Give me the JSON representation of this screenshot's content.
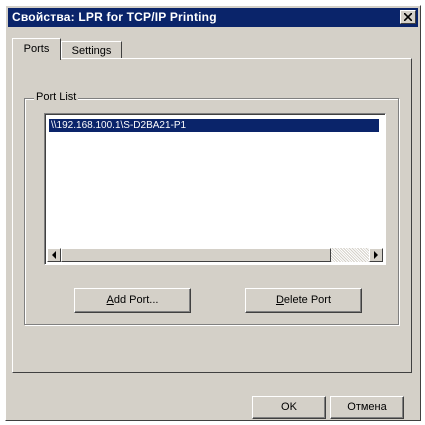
{
  "window": {
    "title": "Свойства: LPR for TCP/IP Printing"
  },
  "tabs": [
    {
      "label": "Ports"
    },
    {
      "label": "Settings"
    }
  ],
  "port_list": {
    "label": "Port List",
    "items": [
      "\\\\192.168.100.1\\S-D2BA21-P1"
    ]
  },
  "buttons": {
    "add_mnemonic": "A",
    "add_rest": "dd Port...",
    "delete_mnemonic": "D",
    "delete_rest": "elete Port",
    "ok": "OK",
    "cancel": "Отмена"
  },
  "colors": {
    "titlebar": "#0a246a",
    "face": "#d4d0c8",
    "selection": "#0a246a"
  },
  "icons": [
    "close-icon",
    "arrow-left-icon",
    "arrow-right-icon"
  ]
}
